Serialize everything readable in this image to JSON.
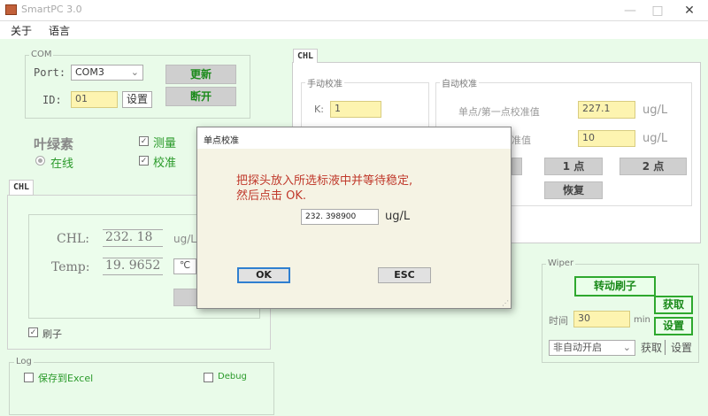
{
  "window": {
    "title": "SmartPC 3.0",
    "minimize": "—",
    "maximize": "□",
    "close": "✕"
  },
  "menu": {
    "about": "关于",
    "language": "语言"
  },
  "com": {
    "group_title": "COM",
    "port_label": "Port:",
    "port_value": "COM3",
    "id_label": "ID:",
    "id_value": "01",
    "set_button": "设置",
    "update_button": "更新",
    "disconnect_button": "断开"
  },
  "status": {
    "chlorophyll": "叶绿素",
    "online": "在线",
    "measure": "测量",
    "calibrate": "校准"
  },
  "left_tab": {
    "tab_label": "CHL",
    "chl_label": "CHL:",
    "chl_value": "232. 18",
    "chl_unit": "ug/L",
    "temp_label": "Temp:",
    "temp_value": "19. 9652",
    "temp_unit_icon": "℃",
    "brush_label": "刷子"
  },
  "log": {
    "group_title": "Log",
    "save_excel": "保存到Excel",
    "debug": "Debug"
  },
  "right_tab": {
    "tab_label": "CHL",
    "manual_group": "手动校准",
    "k_label": "K:",
    "k_value": "1",
    "auto_group": "自动校准",
    "point1_label": "单点/第一点校准值",
    "point1_value": "227.1",
    "point1_unit": "ug/L",
    "point2_label_partial": "准值",
    "point2_value": "10",
    "point2_unit": "ug/L",
    "one_point_button": "1 点",
    "two_point_button": "2 点",
    "restore_button": "恢复"
  },
  "wiper": {
    "group_title": "Wiper",
    "rotate_button": "转动刷子",
    "get_button": "获取",
    "set_button": "设置",
    "time_label": "时间",
    "time_value": "30",
    "time_unit": "min",
    "mode_value": "非自动开启",
    "get_link": "获取",
    "set_link": "设置"
  },
  "dialog": {
    "title": "单点校准",
    "message": "把探头放入所选标液中并等待稳定,\n然后点击 OK.",
    "value": "232. 398900",
    "unit": "ug/L",
    "ok_button": "OK",
    "esc_button": "ESC"
  }
}
